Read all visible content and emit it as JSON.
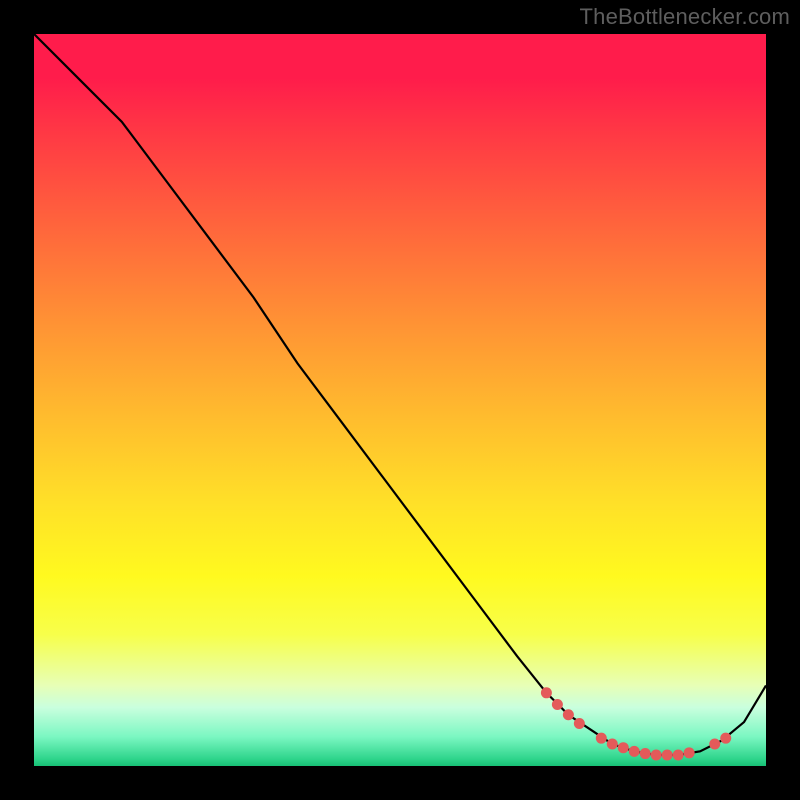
{
  "attribution": "TheBottlenecker.com",
  "chart_data": {
    "type": "line",
    "title": "",
    "xlabel": "",
    "ylabel": "",
    "xlim": [
      0,
      100
    ],
    "ylim": [
      0,
      100
    ],
    "series": [
      {
        "name": "curve",
        "x": [
          0,
          6,
          12,
          18,
          24,
          30,
          36,
          42,
          48,
          54,
          60,
          66,
          70,
          73,
          76,
          79,
          82,
          85,
          88,
          91,
          94,
          97,
          100
        ],
        "y": [
          100,
          94,
          88,
          80,
          72,
          64,
          55,
          47,
          39,
          31,
          23,
          15,
          10,
          7,
          5,
          3,
          2,
          1.5,
          1.5,
          2,
          3.5,
          6,
          11
        ]
      }
    ],
    "markers": [
      {
        "x": 70.0,
        "y": 10.0
      },
      {
        "x": 71.5,
        "y": 8.4
      },
      {
        "x": 73.0,
        "y": 7.0
      },
      {
        "x": 74.5,
        "y": 5.8
      },
      {
        "x": 77.5,
        "y": 3.8
      },
      {
        "x": 79.0,
        "y": 3.0
      },
      {
        "x": 80.5,
        "y": 2.5
      },
      {
        "x": 82.0,
        "y": 2.0
      },
      {
        "x": 83.5,
        "y": 1.7
      },
      {
        "x": 85.0,
        "y": 1.5
      },
      {
        "x": 86.5,
        "y": 1.5
      },
      {
        "x": 88.0,
        "y": 1.5
      },
      {
        "x": 89.5,
        "y": 1.8
      },
      {
        "x": 93.0,
        "y": 3.0
      },
      {
        "x": 94.5,
        "y": 3.8
      }
    ],
    "marker_radius": 5.5,
    "marker_color": "#e45a5a",
    "line_color": "#000000",
    "line_width": 2.2
  }
}
